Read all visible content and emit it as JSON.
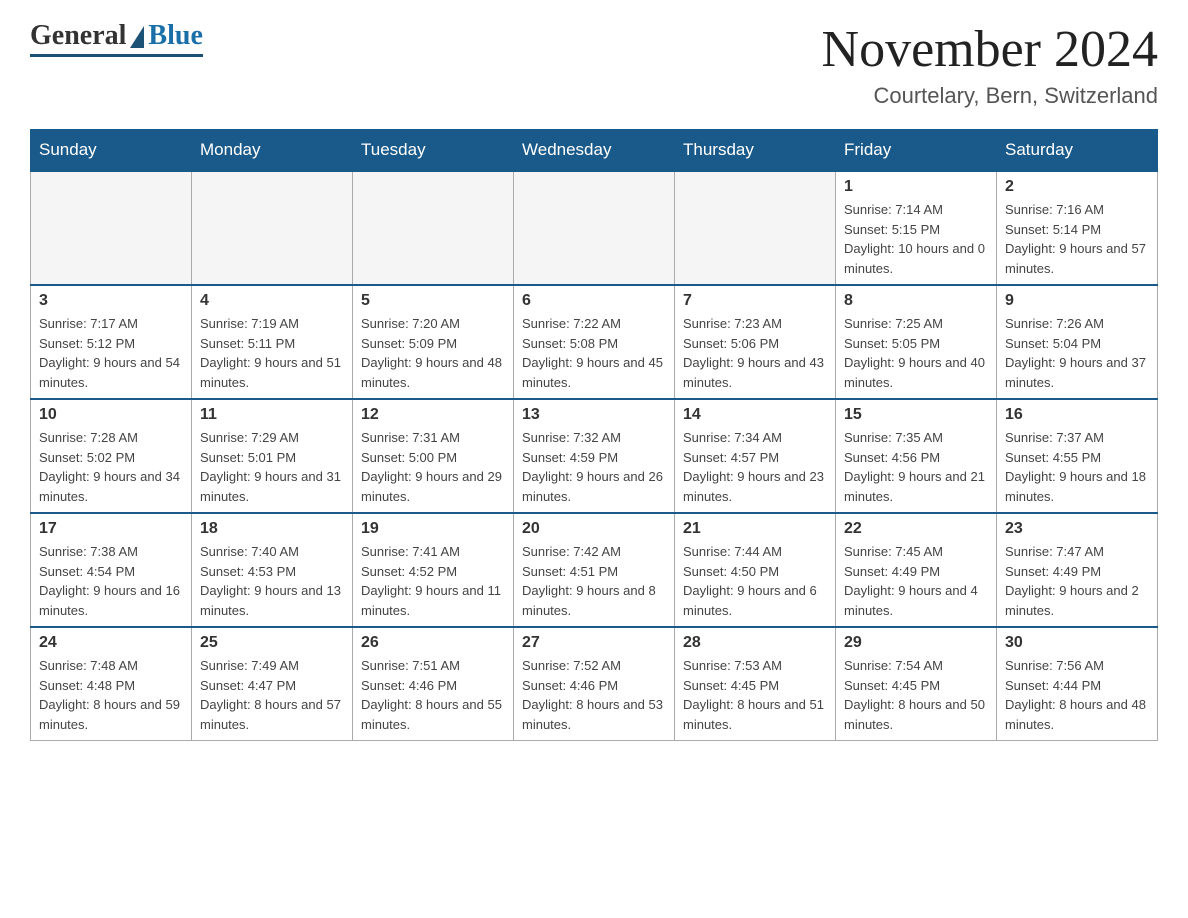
{
  "header": {
    "logo_general": "General",
    "logo_blue": "Blue",
    "month_title": "November 2024",
    "location": "Courtelary, Bern, Switzerland"
  },
  "weekdays": [
    "Sunday",
    "Monday",
    "Tuesday",
    "Wednesday",
    "Thursday",
    "Friday",
    "Saturday"
  ],
  "weeks": [
    [
      {
        "day": "",
        "info": ""
      },
      {
        "day": "",
        "info": ""
      },
      {
        "day": "",
        "info": ""
      },
      {
        "day": "",
        "info": ""
      },
      {
        "day": "",
        "info": ""
      },
      {
        "day": "1",
        "info": "Sunrise: 7:14 AM\nSunset: 5:15 PM\nDaylight: 10 hours and 0 minutes."
      },
      {
        "day": "2",
        "info": "Sunrise: 7:16 AM\nSunset: 5:14 PM\nDaylight: 9 hours and 57 minutes."
      }
    ],
    [
      {
        "day": "3",
        "info": "Sunrise: 7:17 AM\nSunset: 5:12 PM\nDaylight: 9 hours and 54 minutes."
      },
      {
        "day": "4",
        "info": "Sunrise: 7:19 AM\nSunset: 5:11 PM\nDaylight: 9 hours and 51 minutes."
      },
      {
        "day": "5",
        "info": "Sunrise: 7:20 AM\nSunset: 5:09 PM\nDaylight: 9 hours and 48 minutes."
      },
      {
        "day": "6",
        "info": "Sunrise: 7:22 AM\nSunset: 5:08 PM\nDaylight: 9 hours and 45 minutes."
      },
      {
        "day": "7",
        "info": "Sunrise: 7:23 AM\nSunset: 5:06 PM\nDaylight: 9 hours and 43 minutes."
      },
      {
        "day": "8",
        "info": "Sunrise: 7:25 AM\nSunset: 5:05 PM\nDaylight: 9 hours and 40 minutes."
      },
      {
        "day": "9",
        "info": "Sunrise: 7:26 AM\nSunset: 5:04 PM\nDaylight: 9 hours and 37 minutes."
      }
    ],
    [
      {
        "day": "10",
        "info": "Sunrise: 7:28 AM\nSunset: 5:02 PM\nDaylight: 9 hours and 34 minutes."
      },
      {
        "day": "11",
        "info": "Sunrise: 7:29 AM\nSunset: 5:01 PM\nDaylight: 9 hours and 31 minutes."
      },
      {
        "day": "12",
        "info": "Sunrise: 7:31 AM\nSunset: 5:00 PM\nDaylight: 9 hours and 29 minutes."
      },
      {
        "day": "13",
        "info": "Sunrise: 7:32 AM\nSunset: 4:59 PM\nDaylight: 9 hours and 26 minutes."
      },
      {
        "day": "14",
        "info": "Sunrise: 7:34 AM\nSunset: 4:57 PM\nDaylight: 9 hours and 23 minutes."
      },
      {
        "day": "15",
        "info": "Sunrise: 7:35 AM\nSunset: 4:56 PM\nDaylight: 9 hours and 21 minutes."
      },
      {
        "day": "16",
        "info": "Sunrise: 7:37 AM\nSunset: 4:55 PM\nDaylight: 9 hours and 18 minutes."
      }
    ],
    [
      {
        "day": "17",
        "info": "Sunrise: 7:38 AM\nSunset: 4:54 PM\nDaylight: 9 hours and 16 minutes."
      },
      {
        "day": "18",
        "info": "Sunrise: 7:40 AM\nSunset: 4:53 PM\nDaylight: 9 hours and 13 minutes."
      },
      {
        "day": "19",
        "info": "Sunrise: 7:41 AM\nSunset: 4:52 PM\nDaylight: 9 hours and 11 minutes."
      },
      {
        "day": "20",
        "info": "Sunrise: 7:42 AM\nSunset: 4:51 PM\nDaylight: 9 hours and 8 minutes."
      },
      {
        "day": "21",
        "info": "Sunrise: 7:44 AM\nSunset: 4:50 PM\nDaylight: 9 hours and 6 minutes."
      },
      {
        "day": "22",
        "info": "Sunrise: 7:45 AM\nSunset: 4:49 PM\nDaylight: 9 hours and 4 minutes."
      },
      {
        "day": "23",
        "info": "Sunrise: 7:47 AM\nSunset: 4:49 PM\nDaylight: 9 hours and 2 minutes."
      }
    ],
    [
      {
        "day": "24",
        "info": "Sunrise: 7:48 AM\nSunset: 4:48 PM\nDaylight: 8 hours and 59 minutes."
      },
      {
        "day": "25",
        "info": "Sunrise: 7:49 AM\nSunset: 4:47 PM\nDaylight: 8 hours and 57 minutes."
      },
      {
        "day": "26",
        "info": "Sunrise: 7:51 AM\nSunset: 4:46 PM\nDaylight: 8 hours and 55 minutes."
      },
      {
        "day": "27",
        "info": "Sunrise: 7:52 AM\nSunset: 4:46 PM\nDaylight: 8 hours and 53 minutes."
      },
      {
        "day": "28",
        "info": "Sunrise: 7:53 AM\nSunset: 4:45 PM\nDaylight: 8 hours and 51 minutes."
      },
      {
        "day": "29",
        "info": "Sunrise: 7:54 AM\nSunset: 4:45 PM\nDaylight: 8 hours and 50 minutes."
      },
      {
        "day": "30",
        "info": "Sunrise: 7:56 AM\nSunset: 4:44 PM\nDaylight: 8 hours and 48 minutes."
      }
    ]
  ]
}
